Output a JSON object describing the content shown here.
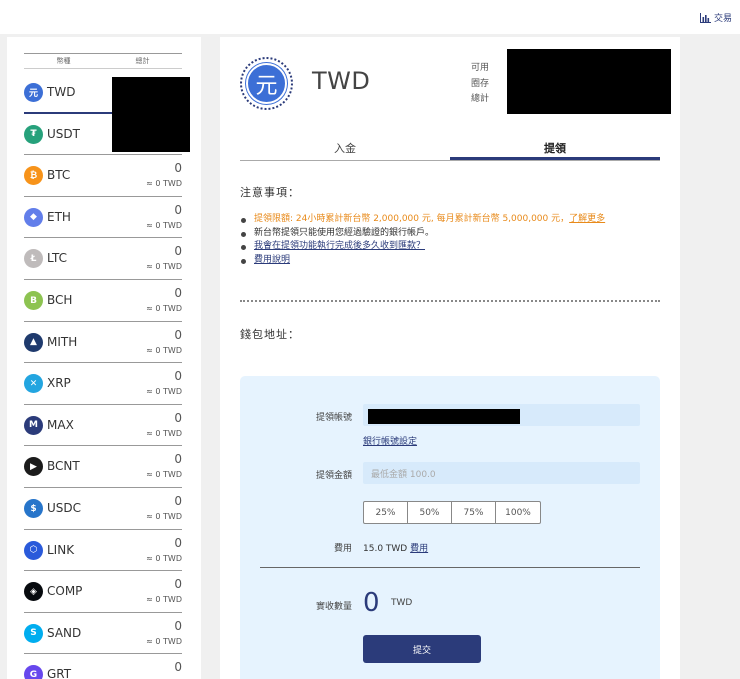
{
  "topbar": {
    "trade_label": "交易",
    "trade_icon": "bar-chart-icon"
  },
  "sidebar": {
    "col_currency": "幣種",
    "col_total": "總計",
    "coins": [
      {
        "name": "TWD",
        "balance": "",
        "sub": "",
        "color": "#3c6fd6",
        "glyph": "元"
      },
      {
        "name": "USDT",
        "balance": "",
        "sub": "",
        "color": "#26a17b",
        "glyph": "₮"
      },
      {
        "name": "BTC",
        "balance": "0",
        "sub": "≈ 0 TWD",
        "color": "#f7931a",
        "glyph": "₿"
      },
      {
        "name": "ETH",
        "balance": "0",
        "sub": "≈ 0 TWD",
        "color": "#627eea",
        "glyph": "◆"
      },
      {
        "name": "LTC",
        "balance": "0",
        "sub": "≈ 0 TWD",
        "color": "#bfbbbb",
        "glyph": "Ł"
      },
      {
        "name": "BCH",
        "balance": "0",
        "sub": "≈ 0 TWD",
        "color": "#8dc351",
        "glyph": "B"
      },
      {
        "name": "MITH",
        "balance": "0",
        "sub": "≈ 0 TWD",
        "color": "#1f3a6d",
        "glyph": "▲"
      },
      {
        "name": "XRP",
        "balance": "0",
        "sub": "≈ 0 TWD",
        "color": "#23a5e0",
        "glyph": "✕"
      },
      {
        "name": "MAX",
        "balance": "0",
        "sub": "≈ 0 TWD",
        "color": "#2b3b7a",
        "glyph": "M"
      },
      {
        "name": "BCNT",
        "balance": "0",
        "sub": "≈ 0 TWD",
        "color": "#1b1b1b",
        "glyph": "▶"
      },
      {
        "name": "USDC",
        "balance": "0",
        "sub": "≈ 0 TWD",
        "color": "#2775ca",
        "glyph": "$"
      },
      {
        "name": "LINK",
        "balance": "0",
        "sub": "≈ 0 TWD",
        "color": "#2a5ada",
        "glyph": "⬡"
      },
      {
        "name": "COMP",
        "balance": "0",
        "sub": "≈ 0 TWD",
        "color": "#070a0e",
        "glyph": "◈"
      },
      {
        "name": "SAND",
        "balance": "0",
        "sub": "≈ 0 TWD",
        "color": "#00adef",
        "glyph": "S"
      },
      {
        "name": "GRT",
        "balance": "0",
        "sub": "",
        "color": "#6747ed",
        "glyph": "G"
      }
    ]
  },
  "main": {
    "currency_logo": "元",
    "currency_title": "TWD",
    "balance_labels": {
      "available": "可用",
      "locked": "圈存",
      "total": "總計"
    },
    "tabs": [
      {
        "label": "入金"
      },
      {
        "label": "提領"
      }
    ],
    "notes_title": "注意事項：",
    "notes": {
      "limit": "提領限額: 24小時累計新台幣 2,000,000 元, 每月累計新台幣 5,000,000 元，",
      "limit_link": "了解更多",
      "bank_only": "新台幣提領只能使用您經過驗證的銀行帳戶。",
      "how_long_link": "我會在提領功能執行完成後多久收到匯款？",
      "fee_link": "費用說明"
    },
    "wallet_label": "錢包地址：",
    "form": {
      "account_label": "提領帳號",
      "account_link": "銀行帳號設定",
      "amount_label": "提領金額",
      "amount_placeholder": "最低金額 100.0",
      "percent_options": [
        "25%",
        "50%",
        "75%",
        "100%"
      ],
      "fee_label": "費用",
      "fee_value": "15.0 TWD",
      "fee_link": "費用",
      "receive_label": "實收數量",
      "receive_amount": "0",
      "receive_unit": "TWD",
      "submit_label": "提交"
    }
  }
}
